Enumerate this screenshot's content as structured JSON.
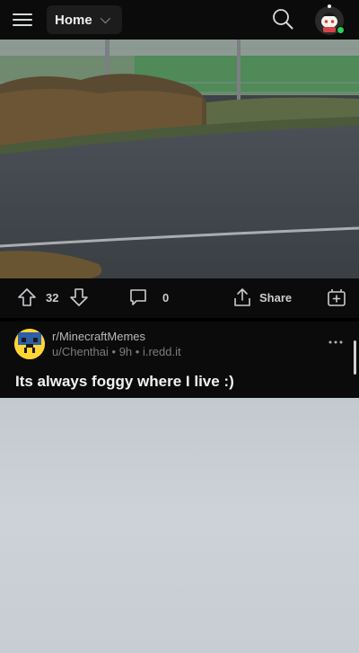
{
  "header": {
    "feed_label": "Home",
    "menu_icon": "hamburger-menu-icon",
    "search_icon": "search-icon",
    "avatar_icon": "user-avatar",
    "online_color": "#2bcf5b"
  },
  "prev_post": {
    "upvote_count": "32",
    "comment_count": "0",
    "share_label": "Share"
  },
  "post": {
    "subreddit": "r/MinecraftMemes",
    "author": "u/Chenthai",
    "age": "9h",
    "domain": "i.redd.it",
    "title": "Its always foggy where I live :)"
  },
  "colors": {
    "background": "#0b0b0b",
    "text": "#d7dadc",
    "sub_avatar": "#ffd635"
  }
}
